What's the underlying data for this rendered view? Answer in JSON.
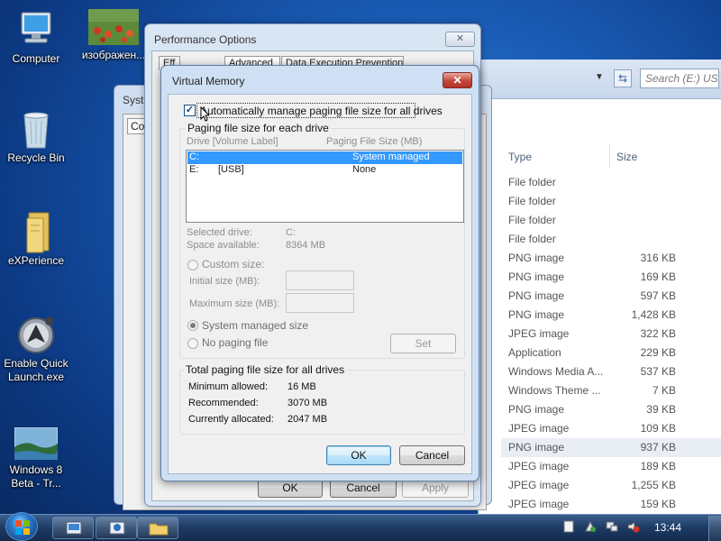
{
  "desktop": {
    "icons": [
      {
        "label": "Computer"
      },
      {
        "label": "изображен..."
      },
      {
        "label": "Recycle Bin"
      },
      {
        "label": "eXPerience"
      },
      {
        "label": "Enable Quick\nLaunch.exe"
      },
      {
        "label": "Windows 8\nBeta - Tr..."
      }
    ]
  },
  "explorer": {
    "search_placeholder": "Search (E:) USB",
    "columns": {
      "type": "Type",
      "size": "Size"
    },
    "rows": [
      {
        "type": "File folder",
        "size": ""
      },
      {
        "type": "File folder",
        "size": ""
      },
      {
        "type": "File folder",
        "size": ""
      },
      {
        "type": "File folder",
        "size": ""
      },
      {
        "type": "PNG image",
        "size": "316 KB"
      },
      {
        "type": "PNG image",
        "size": "169 KB"
      },
      {
        "type": "PNG image",
        "size": "597 KB"
      },
      {
        "type": "PNG image",
        "size": "1,428 KB"
      },
      {
        "type": "JPEG image",
        "size": "322 KB"
      },
      {
        "type": "Application",
        "size": "229 KB"
      },
      {
        "type": "Windows Media A...",
        "size": "537 KB"
      },
      {
        "type": "Windows Theme ...",
        "size": "7 KB"
      },
      {
        "type": "PNG image",
        "size": "39 KB"
      },
      {
        "type": "JPEG image",
        "size": "109 KB"
      },
      {
        "type": "PNG image",
        "size": "937 KB"
      },
      {
        "type": "JPEG image",
        "size": "189 KB"
      },
      {
        "type": "JPEG image",
        "size": "1,255 KB"
      },
      {
        "type": "JPEG image",
        "size": "159 KB"
      }
    ]
  },
  "system_properties": {
    "title_partial": "Syst",
    "tab_partial": "Co"
  },
  "performance_options": {
    "title": "Performance Options",
    "tabs": [
      "Eff",
      "Advanced",
      "Data Execution Prevention"
    ],
    "buttons": {
      "ok": "OK",
      "cancel": "Cancel",
      "apply": "Apply"
    }
  },
  "virtual_memory": {
    "title": "Virtual Memory",
    "auto_manage_label": "Automatically manage paging file size for all drives",
    "auto_manage_checked": true,
    "group_label": "Paging file size for each drive",
    "list_headers": {
      "drive": "Drive  [Volume Label]",
      "paging": "Paging File Size (MB)"
    },
    "drives": [
      {
        "drive": "C:",
        "label": "",
        "paging": "System managed"
      },
      {
        "drive": "E:",
        "label": "[USB]",
        "paging": "None"
      }
    ],
    "selected_drive_label": "Selected drive:",
    "selected_drive_value": "C:",
    "space_available_label": "Space available:",
    "space_available_value": "8364 MB",
    "custom_size_label": "Custom size:",
    "initial_size_label": "Initial size (MB):",
    "maximum_size_label": "Maximum size (MB):",
    "system_managed_label": "System managed size",
    "no_paging_label": "No paging file",
    "set_button": "Set",
    "totals_group_label": "Total paging file size for all drives",
    "minimum_allowed_label": "Minimum allowed:",
    "minimum_allowed_value": "16 MB",
    "recommended_label": "Recommended:",
    "recommended_value": "3070 MB",
    "currently_allocated_label": "Currently allocated:",
    "currently_allocated_value": "2047 MB",
    "ok_button": "OK",
    "cancel_button": "Cancel"
  },
  "taskbar": {
    "clock": "13:44"
  },
  "colors": {
    "selection": "#3399ff",
    "close_button": "#c4463a",
    "desktop": "#1a5bb4"
  }
}
